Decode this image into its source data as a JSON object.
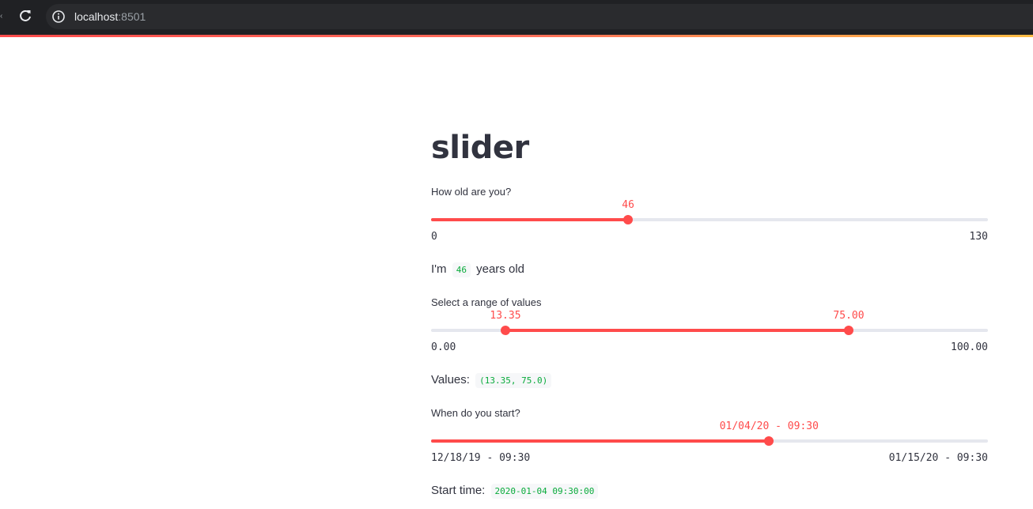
{
  "browser": {
    "url_host": "localhost",
    "url_port": ":8501"
  },
  "page": {
    "title": "slider"
  },
  "age_slider": {
    "label": "How old are you?",
    "value": 46,
    "value_label": "46",
    "min": 0,
    "max": 130,
    "min_label": "0",
    "max_label": "130"
  },
  "age_text": {
    "prefix": "I'm",
    "value": "46",
    "suffix": "years old"
  },
  "range_slider": {
    "label": "Select a range of values",
    "low": 13.35,
    "high": 75.0,
    "low_label": "13.35",
    "high_label": "75.00",
    "min": 0,
    "max": 100,
    "min_label": "0.00",
    "max_label": "100.00"
  },
  "range_text": {
    "prefix": "Values:",
    "value": "(13.35, 75.0)"
  },
  "date_slider": {
    "label": "When do you start?",
    "value_fraction": 0.607,
    "value_label": "01/04/20 - 09:30",
    "min_label": "12/18/19 - 09:30",
    "max_label": "01/15/20 - 09:30"
  },
  "date_text": {
    "prefix": "Start time:",
    "value": "2020-01-04 09:30:00"
  },
  "colors": {
    "accent": "#ff4b4b",
    "track": "#e5e7ee",
    "code_text": "#09ab3b"
  }
}
